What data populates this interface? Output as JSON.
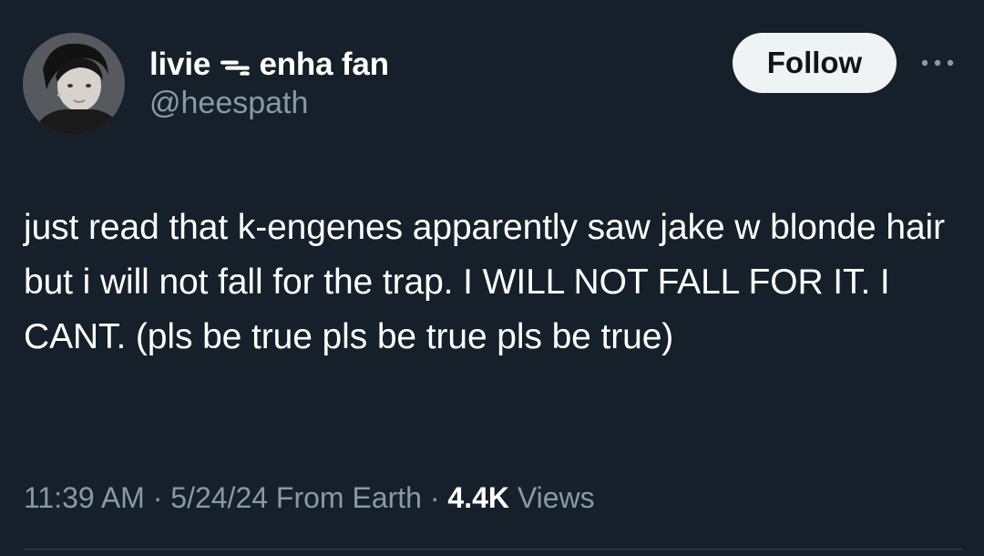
{
  "tweet": {
    "author": {
      "display_name": "livie ᯓ enha fan",
      "handle": "@heespath",
      "avatar_icon": "profile-photo"
    },
    "actions": {
      "follow_label": "Follow",
      "more_icon": "more-horizontal-icon"
    },
    "text": "just read that k-engenes apparently saw jake w blonde hair but i will not fall for the trap. I WILL NOT FALL FOR IT. I CANT. (pls be true pls be true pls be true)",
    "meta": {
      "time": "11:39 AM",
      "separator_1": " · ",
      "date": "5/24/24",
      "source": " From Earth",
      "separator_2": " · ",
      "views_count": "4.4K",
      "views_label": " Views"
    },
    "colors": {
      "background": "#15202b",
      "text": "#ffffff",
      "secondary_text": "#8b98a5",
      "follow_button_bg": "#eff3f4"
    }
  }
}
